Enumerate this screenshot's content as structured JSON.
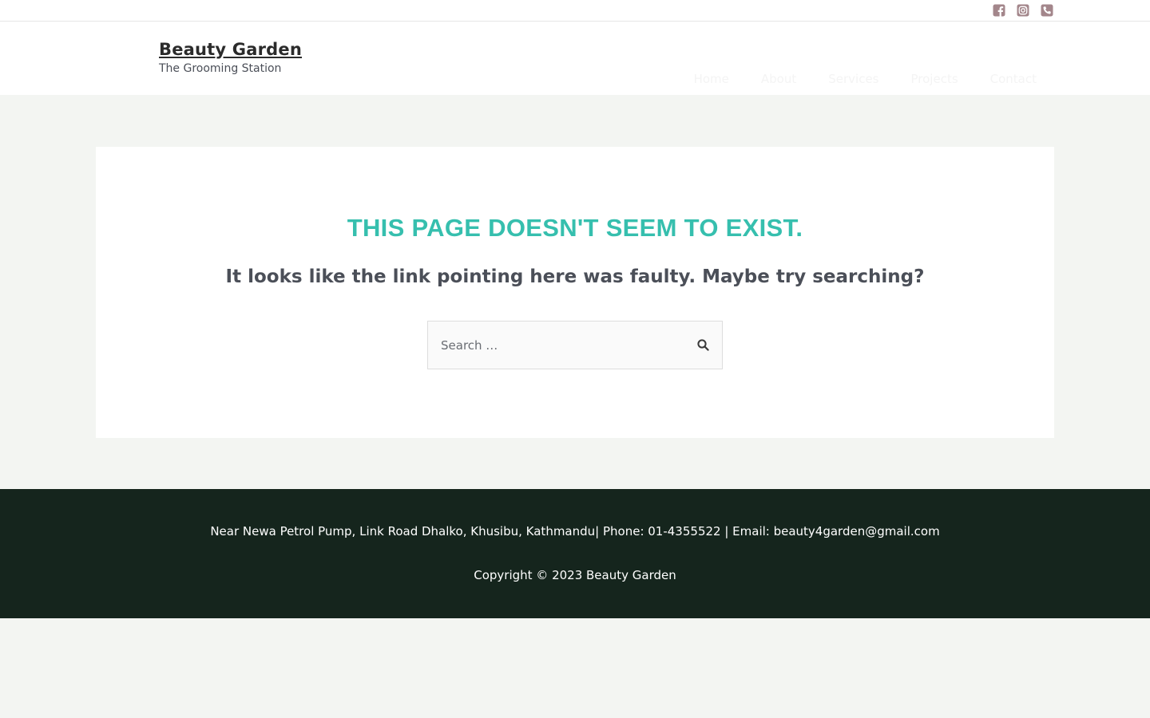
{
  "topbar": {
    "icons": [
      "facebook-icon",
      "instagram-icon",
      "phone-icon"
    ],
    "icon_color": "#a3868b"
  },
  "header": {
    "site_title": "Beauty Garden",
    "tagline": "The Grooming Station",
    "nav": [
      "Home",
      "About",
      "Services",
      "Projects",
      "Contact"
    ]
  },
  "main": {
    "title": "THIS PAGE DOESN'T SEEM TO EXIST.",
    "subtitle": "It looks like the link pointing here was faulty. Maybe try searching?",
    "search": {
      "placeholder": "Search …",
      "value": ""
    }
  },
  "footer": {
    "contact": "Near Newa Petrol Pump, Link Road Dhalko, Khusibu, Kathmandu| Phone: 01-4355522 | Email: beauty4garden@gmail.com",
    "copyright": "Copyright © 2023 Beauty Garden"
  },
  "colors": {
    "accent": "#36bfae",
    "footer_bg": "#15251d",
    "page_bg": "#f3f5f2"
  }
}
